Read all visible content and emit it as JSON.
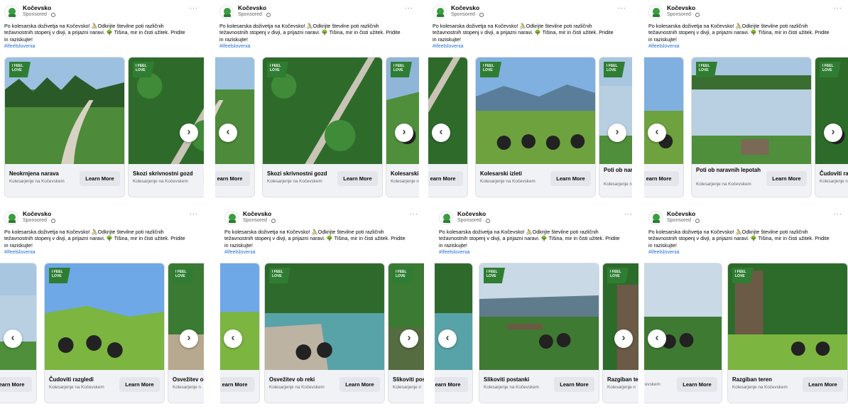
{
  "post": {
    "page_name": "Kočevsko",
    "sponsored": "Sponsored",
    "more": "···",
    "caption": "Po kolesarska doživetja na Kočevsko! 🚴Odkrijte številne poti različnih težavnostnih stopenj v divji, a prijazni naravi. 🌳 Tišina, mir in čisti užitek. Pridite in raziskujte!",
    "hashtag": "#ifeelslovenia",
    "badge": "I FEEL SLOVENIA"
  },
  "cta": "Learn More",
  "cta_partial": "earn More",
  "cards": [
    {
      "title": "Neokrnjena narava",
      "subtitle": "Kolesarjenje na Kočevskem",
      "scene": "road"
    },
    {
      "title": "Skozi skrivnostni gozd",
      "subtitle": "Kolesarjenje na Kočevskem",
      "scene": "forest"
    },
    {
      "title": "Kolesarski izleti",
      "subtitle": "Kolesarjenje na Kočevskem",
      "scene": "valley"
    },
    {
      "title": "Poti ob naravnih lepotah",
      "subtitle": "Kolesarjenje na Kočevskem",
      "scene": "lake"
    },
    {
      "title": "Čudoviti razgledi",
      "subtitle": "Kolesarjenje na Kočevskem",
      "scene": "meadow"
    },
    {
      "title": "Osvežitev ob reki",
      "subtitle": "Kolesarjenje na Kočevskem",
      "scene": "river"
    },
    {
      "title": "Slikoviti postanki",
      "subtitle": "Kolesarjenje na Kočevskem",
      "scene": "lookout"
    },
    {
      "title": "Razgiban teren",
      "subtitle": "Kolesarjenje na Kočevskem",
      "scene": "tree"
    }
  ],
  "truncated_titles": {
    "poti": "Poti ob nara lepotah",
    "kolesarski": "Kolesarski i",
    "cudoviti": "Čudoviti raz",
    "osvezitev": "Osvežitev ol",
    "slikoviti": "Slikoviti pos",
    "razgiban": "Razgiban te",
    "kolesarjenje_short": "Kolesarjenje n",
    "kolesarjenje_tail": "evskem"
  },
  "panels": [
    {
      "id": "p1",
      "active": 1,
      "arrows": [
        "right"
      ]
    },
    {
      "id": "p2",
      "active": 2,
      "arrows": [
        "left",
        "right"
      ]
    },
    {
      "id": "p3",
      "active": 3,
      "arrows": [
        "left",
        "right"
      ]
    },
    {
      "id": "p4",
      "active": 4,
      "arrows": [
        "left",
        "right"
      ]
    },
    {
      "id": "p5",
      "active": 5,
      "arrows": [
        "left",
        "right"
      ]
    },
    {
      "id": "p6",
      "active": 6,
      "arrows": [
        "left",
        "right"
      ]
    },
    {
      "id": "p7",
      "active": 7,
      "arrows": [
        "left",
        "right"
      ]
    },
    {
      "id": "p8",
      "active": 8,
      "arrows": [
        "left"
      ]
    }
  ],
  "icons": {
    "avatar": "kocevsko-logo-icon",
    "globe": "globe-icon",
    "more": "more-options-icon",
    "arrow_left": "chevron-left-icon",
    "arrow_right": "chevron-right-icon"
  },
  "colors": {
    "link": "#216fdb",
    "badge": "#2f7d32",
    "button": "#e4e6eb",
    "footer": "#f0f2f5"
  }
}
